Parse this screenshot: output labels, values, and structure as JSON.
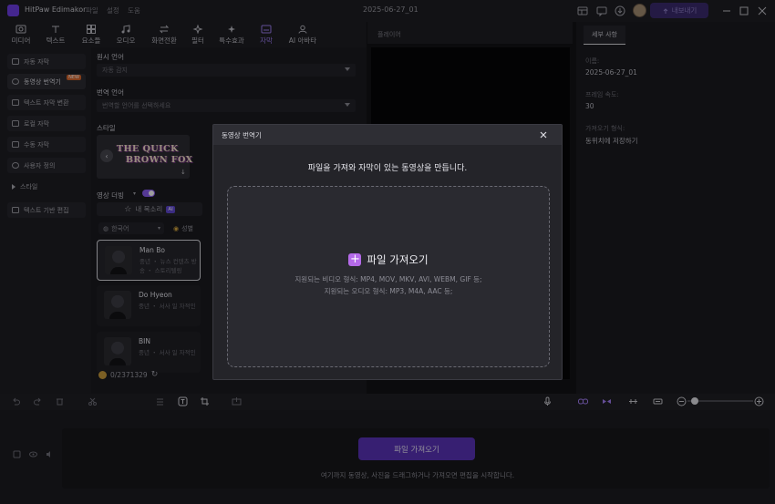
{
  "titlebar": {
    "app_name": "HitPaw Edimakor",
    "menu": [
      "파일",
      "설정",
      "도움"
    ],
    "document_title": "2025-06-27_01",
    "export_label": "내보내기",
    "icons": [
      "layout-icon",
      "feedback-icon",
      "download-icon",
      "avatar",
      "minimize-icon",
      "maximize-icon",
      "close-icon"
    ]
  },
  "toolbar": {
    "tabs": [
      {
        "label": "미디어",
        "icon": "media-icon"
      },
      {
        "label": "텍스트",
        "icon": "text-icon"
      },
      {
        "label": "요소들",
        "icon": "elements-icon"
      },
      {
        "label": "오디오",
        "icon": "audio-icon"
      },
      {
        "label": "화면전환",
        "icon": "transition-icon"
      },
      {
        "label": "필터",
        "icon": "filter-icon"
      },
      {
        "label": "특수효과",
        "icon": "effects-icon"
      },
      {
        "label": "자막",
        "icon": "subtitle-icon",
        "active": true
      },
      {
        "label": "AI 아바타",
        "icon": "avatar-ai-icon"
      }
    ]
  },
  "sidebar": {
    "items": [
      {
        "label": "자동 자막"
      },
      {
        "label": "동영상 번역기",
        "badge": "NEW",
        "active": true
      },
      {
        "label": "텍스트 자막 변환"
      },
      {
        "label": "로컬 자막"
      },
      {
        "label": "수동 자막"
      },
      {
        "label": "사용자 정의"
      },
      {
        "label": "스타일"
      },
      {
        "label": "텍스트 기반 편집"
      }
    ]
  },
  "panel": {
    "source_lang_label": "원시 언어",
    "source_lang_value": "자동 감지",
    "target_lang_label": "번역 언어",
    "target_lang_placeholder": "번역할 언어를 선택하세요",
    "style_label": "스타일",
    "style_preview_line1": "THE QUICK",
    "style_preview_line2": "BROWN FOX",
    "dubbing_label": "영상 더빙",
    "my_voice_label": "내 목소리",
    "my_voice_badge": "AI",
    "lang_filter": "한국어",
    "gender_filter": "성별",
    "voices": [
      {
        "name": "Man Bo",
        "desc": "중년 ・ 뉴스 컨텐츠 방송 ・ 스토리텔링"
      },
      {
        "name": "Do Hyeon",
        "desc": "중년 ・ 서사 일 자적인"
      },
      {
        "name": "BIN",
        "desc": "중년 ・ 서사 일 자적인"
      }
    ],
    "credits": "0/2371329"
  },
  "player": {
    "label": "플레이어"
  },
  "details": {
    "tab": "세부 사항",
    "fields": [
      {
        "label": "이름:",
        "value": "2025-06-27_01"
      },
      {
        "label": "프레임 속도:",
        "value": "30"
      },
      {
        "label": "가져오기 형식:",
        "value": "동위치에 저장하기"
      }
    ]
  },
  "timeline": {
    "import_button": "파일 가져오기",
    "hint": "여기까지 동영상, 사진을 드래그하거나 가져오면 편집을 시작합니다."
  },
  "modal": {
    "title": "동영상 번역기",
    "heading": "파일을 가져와 자막이 있는 동영상을 만듭니다.",
    "import_label": "파일 가져오기",
    "video_formats": "지원되는 비디오 형식: MP4, MOV, MKV, AVI, WEBM, GIF 등;",
    "audio_formats": "지원되는 오디오 형식: MP3, M4A, AAC 등;"
  },
  "colors": {
    "accent": "#8a5cf0",
    "import_plus": "#b46ae8",
    "timeline_button": "#5a33b8",
    "new_badge": "#d7662c"
  }
}
